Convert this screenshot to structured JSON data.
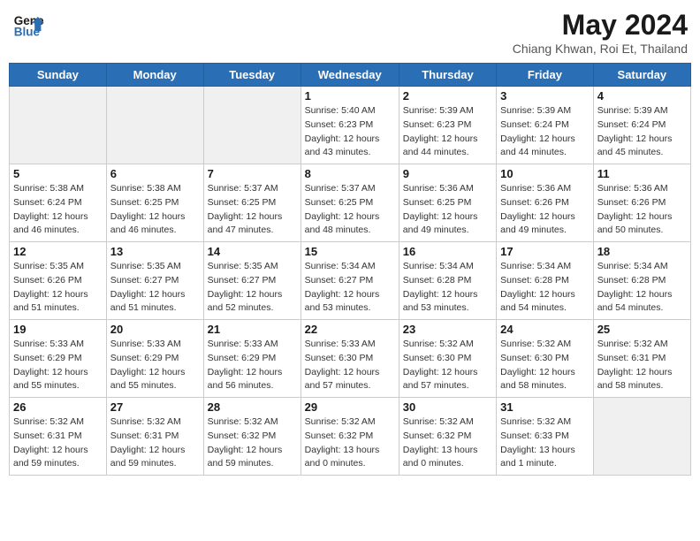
{
  "header": {
    "logo_line1": "General",
    "logo_line2": "Blue",
    "month": "May 2024",
    "location": "Chiang Khwan, Roi Et, Thailand"
  },
  "days_of_week": [
    "Sunday",
    "Monday",
    "Tuesday",
    "Wednesday",
    "Thursday",
    "Friday",
    "Saturday"
  ],
  "weeks": [
    [
      {
        "day": "",
        "info": ""
      },
      {
        "day": "",
        "info": ""
      },
      {
        "day": "",
        "info": ""
      },
      {
        "day": "1",
        "info": "Sunrise: 5:40 AM\nSunset: 6:23 PM\nDaylight: 12 hours\nand 43 minutes."
      },
      {
        "day": "2",
        "info": "Sunrise: 5:39 AM\nSunset: 6:23 PM\nDaylight: 12 hours\nand 44 minutes."
      },
      {
        "day": "3",
        "info": "Sunrise: 5:39 AM\nSunset: 6:24 PM\nDaylight: 12 hours\nand 44 minutes."
      },
      {
        "day": "4",
        "info": "Sunrise: 5:39 AM\nSunset: 6:24 PM\nDaylight: 12 hours\nand 45 minutes."
      }
    ],
    [
      {
        "day": "5",
        "info": "Sunrise: 5:38 AM\nSunset: 6:24 PM\nDaylight: 12 hours\nand 46 minutes."
      },
      {
        "day": "6",
        "info": "Sunrise: 5:38 AM\nSunset: 6:25 PM\nDaylight: 12 hours\nand 46 minutes."
      },
      {
        "day": "7",
        "info": "Sunrise: 5:37 AM\nSunset: 6:25 PM\nDaylight: 12 hours\nand 47 minutes."
      },
      {
        "day": "8",
        "info": "Sunrise: 5:37 AM\nSunset: 6:25 PM\nDaylight: 12 hours\nand 48 minutes."
      },
      {
        "day": "9",
        "info": "Sunrise: 5:36 AM\nSunset: 6:25 PM\nDaylight: 12 hours\nand 49 minutes."
      },
      {
        "day": "10",
        "info": "Sunrise: 5:36 AM\nSunset: 6:26 PM\nDaylight: 12 hours\nand 49 minutes."
      },
      {
        "day": "11",
        "info": "Sunrise: 5:36 AM\nSunset: 6:26 PM\nDaylight: 12 hours\nand 50 minutes."
      }
    ],
    [
      {
        "day": "12",
        "info": "Sunrise: 5:35 AM\nSunset: 6:26 PM\nDaylight: 12 hours\nand 51 minutes."
      },
      {
        "day": "13",
        "info": "Sunrise: 5:35 AM\nSunset: 6:27 PM\nDaylight: 12 hours\nand 51 minutes."
      },
      {
        "day": "14",
        "info": "Sunrise: 5:35 AM\nSunset: 6:27 PM\nDaylight: 12 hours\nand 52 minutes."
      },
      {
        "day": "15",
        "info": "Sunrise: 5:34 AM\nSunset: 6:27 PM\nDaylight: 12 hours\nand 53 minutes."
      },
      {
        "day": "16",
        "info": "Sunrise: 5:34 AM\nSunset: 6:28 PM\nDaylight: 12 hours\nand 53 minutes."
      },
      {
        "day": "17",
        "info": "Sunrise: 5:34 AM\nSunset: 6:28 PM\nDaylight: 12 hours\nand 54 minutes."
      },
      {
        "day": "18",
        "info": "Sunrise: 5:34 AM\nSunset: 6:28 PM\nDaylight: 12 hours\nand 54 minutes."
      }
    ],
    [
      {
        "day": "19",
        "info": "Sunrise: 5:33 AM\nSunset: 6:29 PM\nDaylight: 12 hours\nand 55 minutes."
      },
      {
        "day": "20",
        "info": "Sunrise: 5:33 AM\nSunset: 6:29 PM\nDaylight: 12 hours\nand 55 minutes."
      },
      {
        "day": "21",
        "info": "Sunrise: 5:33 AM\nSunset: 6:29 PM\nDaylight: 12 hours\nand 56 minutes."
      },
      {
        "day": "22",
        "info": "Sunrise: 5:33 AM\nSunset: 6:30 PM\nDaylight: 12 hours\nand 57 minutes."
      },
      {
        "day": "23",
        "info": "Sunrise: 5:32 AM\nSunset: 6:30 PM\nDaylight: 12 hours\nand 57 minutes."
      },
      {
        "day": "24",
        "info": "Sunrise: 5:32 AM\nSunset: 6:30 PM\nDaylight: 12 hours\nand 58 minutes."
      },
      {
        "day": "25",
        "info": "Sunrise: 5:32 AM\nSunset: 6:31 PM\nDaylight: 12 hours\nand 58 minutes."
      }
    ],
    [
      {
        "day": "26",
        "info": "Sunrise: 5:32 AM\nSunset: 6:31 PM\nDaylight: 12 hours\nand 59 minutes."
      },
      {
        "day": "27",
        "info": "Sunrise: 5:32 AM\nSunset: 6:31 PM\nDaylight: 12 hours\nand 59 minutes."
      },
      {
        "day": "28",
        "info": "Sunrise: 5:32 AM\nSunset: 6:32 PM\nDaylight: 12 hours\nand 59 minutes."
      },
      {
        "day": "29",
        "info": "Sunrise: 5:32 AM\nSunset: 6:32 PM\nDaylight: 13 hours\nand 0 minutes."
      },
      {
        "day": "30",
        "info": "Sunrise: 5:32 AM\nSunset: 6:32 PM\nDaylight: 13 hours\nand 0 minutes."
      },
      {
        "day": "31",
        "info": "Sunrise: 5:32 AM\nSunset: 6:33 PM\nDaylight: 13 hours\nand 1 minute."
      },
      {
        "day": "",
        "info": ""
      }
    ]
  ]
}
